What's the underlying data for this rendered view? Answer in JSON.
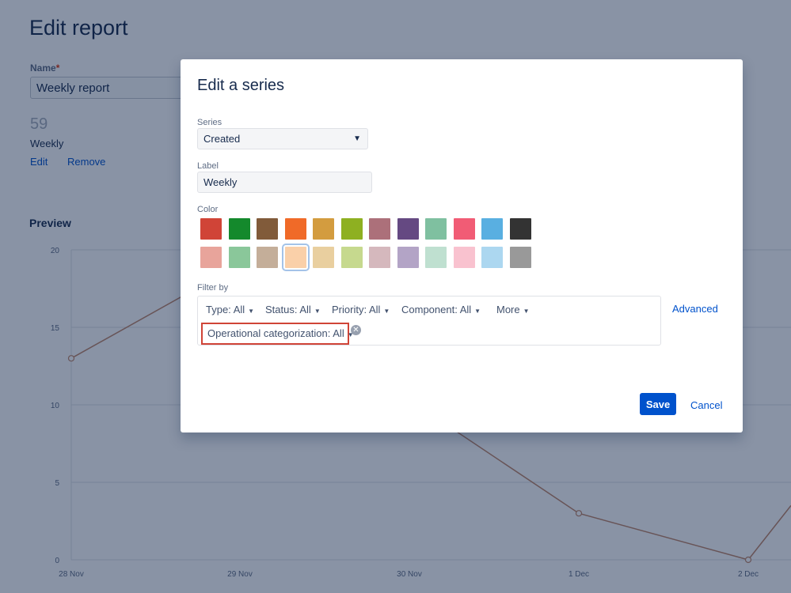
{
  "page": {
    "title": "Edit report",
    "name_label": "Name",
    "name_required_mark": "*",
    "name_value": "Weekly report",
    "series_count": "59",
    "series_name": "Weekly",
    "edit_link": "Edit",
    "remove_link": "Remove",
    "preview_title": "Preview"
  },
  "chart_data": {
    "type": "line",
    "x": [
      "28 Nov",
      "29 Nov",
      "30 Nov",
      "1 Dec",
      "2 Dec"
    ],
    "y_ticks": [
      "0",
      "5",
      "10",
      "15",
      "20"
    ],
    "ylim": [
      0,
      20
    ],
    "series": [
      {
        "values": [
          13,
          null,
          null,
          3,
          0
        ],
        "color": "#c0876a"
      }
    ]
  },
  "modal": {
    "title": "Edit a series",
    "series_label": "Series",
    "series_value": "Created",
    "label_label": "Label",
    "label_value": "Weekly",
    "color_label": "Color",
    "colors": [
      "#d04437",
      "#14892c",
      "#815b3a",
      "#f06a28",
      "#d39c3f",
      "#8eb021",
      "#ac707a",
      "#654982",
      "#7fc0a0",
      "#f15c75",
      "#59afe1",
      "#333333",
      "#e8a49b",
      "#8ac79a",
      "#c4ae99",
      "#fad0a9",
      "#e9cf9f",
      "#c6d98e",
      "#d5b8bd",
      "#b3a4c6",
      "#bfe0d0",
      "#f9c2cf",
      "#acd7f0",
      "#999999"
    ],
    "selected_color_index": 15,
    "filter_label": "Filter by",
    "filters": [
      {
        "label": "Type: All"
      },
      {
        "label": "Status: All"
      },
      {
        "label": "Priority: All"
      },
      {
        "label": "Component: All"
      },
      {
        "label": "More"
      }
    ],
    "oc_filter": "Operational categorization: All",
    "advanced": "Advanced",
    "save": "Save",
    "cancel": "Cancel"
  }
}
